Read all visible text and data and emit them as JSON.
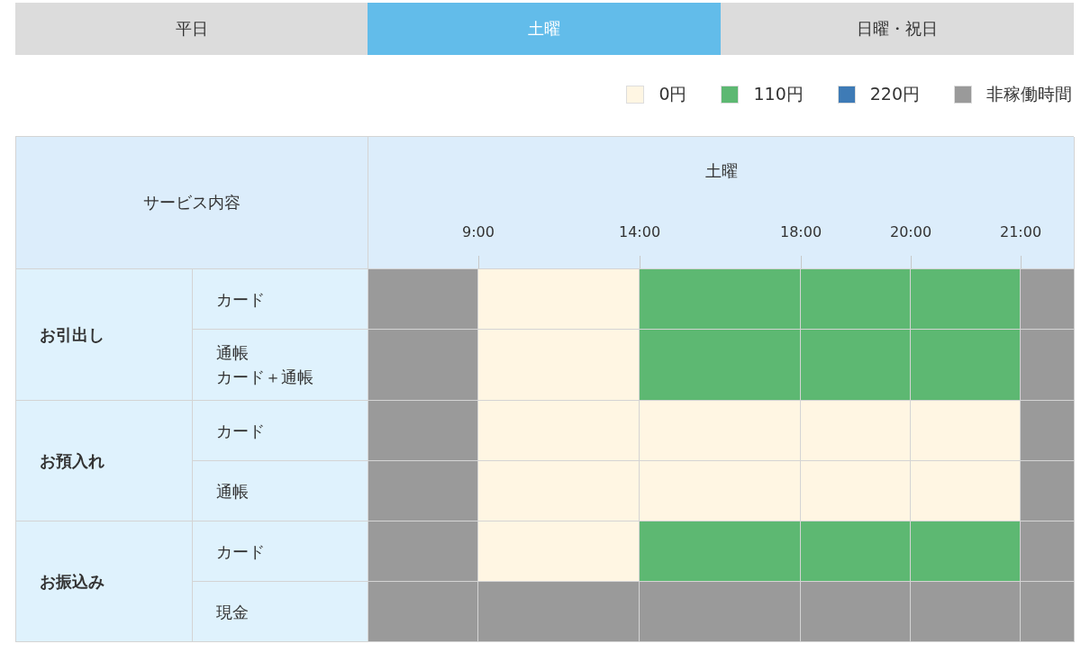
{
  "tabs": [
    {
      "label": "平日",
      "selected": false
    },
    {
      "label": "土曜",
      "selected": true
    },
    {
      "label": "日曜・祝日",
      "selected": false
    }
  ],
  "legend": [
    {
      "kind": "free",
      "label": "0円",
      "color": "#fff6e3"
    },
    {
      "kind": "fee110",
      "label": "110円",
      "color": "#5db872"
    },
    {
      "kind": "fee220",
      "label": "220円",
      "color": "#3e7bb6"
    },
    {
      "kind": "off",
      "label": "非稼働時間",
      "color": "#9a9a9a"
    }
  ],
  "table": {
    "service_header": "サービス内容",
    "day_header": "土曜",
    "times": [
      "9:00",
      "14:00",
      "18:00",
      "20:00",
      "21:00"
    ],
    "groups": [
      {
        "name": "お引出し",
        "rows": [
          {
            "lines": [
              "カード"
            ],
            "cells": [
              {
                "kind": "off"
              },
              {
                "kind": "free"
              },
              {
                "kind": "fee110"
              },
              {
                "kind": "fee110"
              },
              {
                "kind": "fee110"
              },
              {
                "kind": "off"
              }
            ]
          },
          {
            "lines": [
              "通帳",
              "カード＋通帳"
            ],
            "cells": [
              {
                "kind": "off"
              },
              {
                "kind": "free"
              },
              {
                "kind": "fee110"
              },
              {
                "kind": "fee110"
              },
              {
                "kind": "fee110"
              },
              {
                "kind": "off"
              }
            ]
          }
        ]
      },
      {
        "name": "お預入れ",
        "rows": [
          {
            "lines": [
              "カード"
            ],
            "cells": [
              {
                "kind": "off"
              },
              {
                "kind": "free"
              },
              {
                "kind": "free"
              },
              {
                "kind": "free"
              },
              {
                "kind": "free"
              },
              {
                "kind": "off"
              }
            ]
          },
          {
            "lines": [
              "通帳"
            ],
            "cells": [
              {
                "kind": "off"
              },
              {
                "kind": "free"
              },
              {
                "kind": "free"
              },
              {
                "kind": "free"
              },
              {
                "kind": "free"
              },
              {
                "kind": "off"
              }
            ]
          }
        ]
      },
      {
        "name": "お振込み",
        "rows": [
          {
            "lines": [
              "カード"
            ],
            "cells": [
              {
                "kind": "off"
              },
              {
                "kind": "free"
              },
              {
                "kind": "fee110"
              },
              {
                "kind": "fee110"
              },
              {
                "kind": "fee110"
              },
              {
                "kind": "off"
              }
            ]
          },
          {
            "lines": [
              "現金"
            ],
            "cells": [
              {
                "kind": "off"
              },
              {
                "kind": "off"
              },
              {
                "kind": "off"
              },
              {
                "kind": "off"
              },
              {
                "kind": "off"
              },
              {
                "kind": "off"
              }
            ]
          }
        ]
      }
    ]
  }
}
